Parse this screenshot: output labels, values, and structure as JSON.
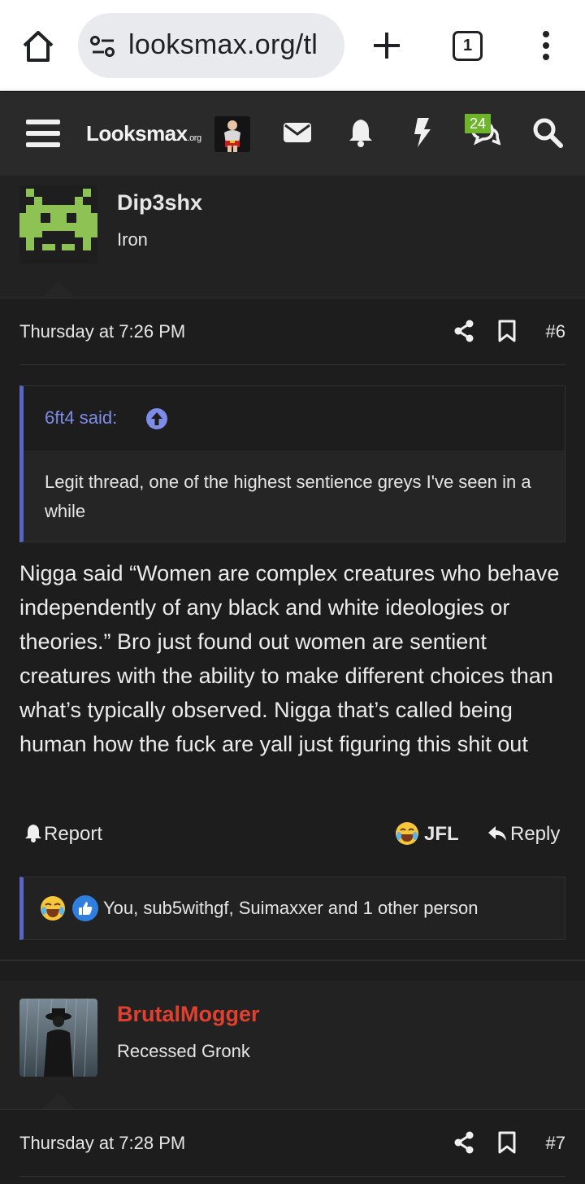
{
  "browser": {
    "url": "looksmax.org/tl",
    "tab_count": "1"
  },
  "site": {
    "logo_main": "Looksmax",
    "logo_suffix": ".org",
    "conversations_badge": "24",
    "accent_color": "#6fb52c"
  },
  "posts": [
    {
      "username": "Dip3shx",
      "username_color": "#b8b8b8",
      "user_title": "Iron",
      "date": "Thursday at 7:26 PM",
      "number": "#6",
      "quote": {
        "author": "6ft4 said:",
        "text": "Legit thread, one of the highest sentience greys I've seen in a while"
      },
      "body": "Nigga said “Women are complex creatures who behave independently of any black and white ideologies or theories.” Bro just found out women are sentient creatures with the ability to make different choices than what’s typically observed. Nigga that’s called being human how the fuck are yall just figuring this shit out",
      "actions": {
        "report": "Report",
        "reaction": "JFL",
        "reply": "Reply"
      },
      "reactions_text": "You, sub5withgf, Suimaxxer and 1 other person"
    },
    {
      "username": "BrutalMogger",
      "username_color": "#e2402f",
      "user_title": "Recessed Gronk",
      "date": "Thursday at 7:28 PM",
      "number": "#7"
    }
  ]
}
